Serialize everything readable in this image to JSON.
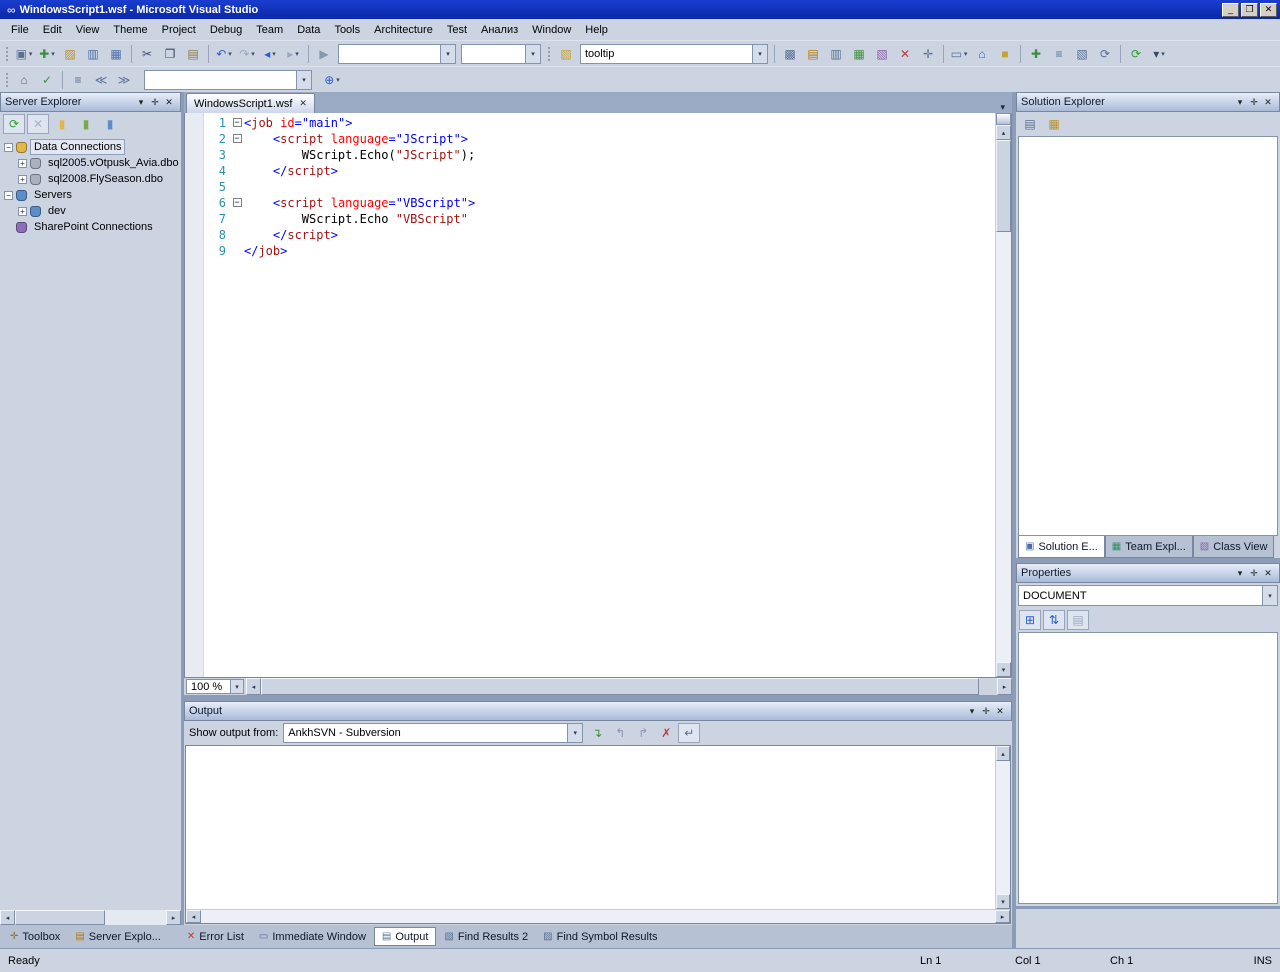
{
  "glyphs": {
    "up": "▴",
    "down": "▾",
    "left": "◂",
    "right": "▸",
    "dd": "▾",
    "menu": "▾",
    "pin": "✛",
    "close": "✕",
    "minimize": "_",
    "restore": "❐",
    "infinity": "∞"
  },
  "window": {
    "title": "WindowsScript1.wsf - Microsoft Visual Studio"
  },
  "menu_bar": {
    "items": [
      "File",
      "Edit",
      "View",
      "Theme",
      "Project",
      "Debug",
      "Team",
      "Data",
      "Tools",
      "Architecture",
      "Test",
      "Анализ",
      "Window",
      "Help"
    ]
  },
  "toolbar_standard": {
    "config_combo": "",
    "platform_combo": "",
    "tooltip_combo": "tooltip",
    "groups": {
      "file": [
        {
          "name": "new-project",
          "glyph": "▣",
          "color": "#5a6f94",
          "split": true
        },
        {
          "name": "add-new-item",
          "glyph": "✚",
          "color": "#3f8f3f",
          "split": true
        },
        {
          "name": "open-file",
          "glyph": "▨",
          "color": "#b8912e"
        },
        {
          "name": "save",
          "glyph": "▥",
          "color": "#4a6da8"
        },
        {
          "name": "save-all",
          "glyph": "▦",
          "color": "#4a6da8"
        }
      ],
      "clipboard": [
        {
          "name": "cut",
          "glyph": "✂",
          "color": "#3a4a66"
        },
        {
          "name": "copy",
          "glyph": "❐",
          "color": "#3a4a66"
        },
        {
          "name": "paste",
          "glyph": "▤",
          "color": "#8a7a4a"
        }
      ],
      "undo_redo": [
        {
          "name": "undo",
          "glyph": "↶",
          "color": "#2b5fd0",
          "split": true
        },
        {
          "name": "redo",
          "glyph": "↷",
          "color": "#9aa7bd",
          "split": true
        },
        {
          "name": "navigate-backward",
          "glyph": "◂",
          "color": "#2b5fd0",
          "split": true
        },
        {
          "name": "navigate-forward",
          "glyph": "▸",
          "color": "#9aa7bd",
          "split": true
        }
      ],
      "run": [
        {
          "name": "start-debug",
          "glyph": "▶",
          "color": "#8a97ad"
        }
      ],
      "find": [
        {
          "name": "find-options",
          "glyph": "▧",
          "color": "#c8a02e"
        }
      ],
      "windows": [
        {
          "name": "find-in-files",
          "glyph": "▩",
          "color": "#5a6f94"
        },
        {
          "name": "solution-explorer",
          "glyph": "▤",
          "color": "#b8780a"
        },
        {
          "name": "properties-window",
          "glyph": "▥",
          "color": "#5a6f94"
        },
        {
          "name": "object-browser",
          "glyph": "▦",
          "color": "#3f8f3f"
        },
        {
          "name": "class-view",
          "glyph": "▧",
          "color": "#8a5fb0"
        },
        {
          "name": "error-list",
          "glyph": "✕",
          "color": "#c03a3a"
        },
        {
          "name": "toolbox",
          "glyph": "✛",
          "color": "#5a6f94"
        }
      ],
      "tail1": [
        {
          "name": "command-window",
          "glyph": "▭",
          "color": "#5a6f94",
          "split": true
        },
        {
          "name": "web-browser",
          "glyph": "⌂",
          "color": "#2b5fd0"
        },
        {
          "name": "extension-manager",
          "glyph": "■",
          "color": "#c8a02e"
        }
      ],
      "tail2": [
        {
          "name": "add-to-source-control",
          "glyph": "✚",
          "color": "#3f8f3f"
        },
        {
          "name": "compare-files",
          "glyph": "≡",
          "color": "#5a6f94"
        },
        {
          "name": "annotate",
          "glyph": "▧",
          "color": "#5a6f94"
        },
        {
          "name": "history",
          "glyph": "⟳",
          "color": "#5a6f94"
        }
      ],
      "tail3": [
        {
          "name": "refresh",
          "glyph": "⟳",
          "color": "#2e9e2e"
        },
        {
          "name": "toolbar-options",
          "glyph": "▾",
          "color": "#3a4a66",
          "split": true
        }
      ]
    }
  },
  "toolbar_html": {
    "combo_value": "",
    "groups": {
      "left": [
        {
          "name": "view-in-browser",
          "glyph": "⌂",
          "color": "#5a6f94"
        },
        {
          "name": "check-syntax",
          "glyph": "✓",
          "color": "#3f8f3f"
        }
      ],
      "format": [
        {
          "name": "format-document",
          "glyph": "≡",
          "color": "#5a6f94"
        },
        {
          "name": "decrease-indent",
          "glyph": "≪",
          "color": "#5a6f94"
        },
        {
          "name": "increase-indent",
          "glyph": "≫",
          "color": "#5a6f94"
        }
      ],
      "browse": [
        {
          "name": "browse-with",
          "glyph": "⊕",
          "color": "#2b5fd0",
          "split": true
        }
      ]
    }
  },
  "server_explorer": {
    "title": "Server Explorer",
    "toolbar": [
      {
        "name": "refresh",
        "glyph": "⟳",
        "color": "#2e9e2e",
        "boxed": true
      },
      {
        "name": "stop-refresh",
        "glyph": "✕",
        "color": "#a8b2c2",
        "boxed": true
      },
      {
        "name": "connect-to-database",
        "glyph": "▮",
        "color": "#e3b64a"
      },
      {
        "name": "create-new-sql-database",
        "glyph": "▮",
        "color": "#7aa84a"
      },
      {
        "name": "connect-to-server",
        "glyph": "▮",
        "color": "#5b8dc8"
      }
    ],
    "tree": [
      {
        "label": "Data Connections",
        "indent": 0,
        "expander": "−",
        "icon": "data-connections",
        "icon_color": "#e3b64a",
        "selected": true
      },
      {
        "label": "sql2005.vOtpusk_Avia.dbo",
        "indent": 1,
        "expander": "+",
        "icon": "database",
        "icon_color": "#aab2c0",
        "selected": false
      },
      {
        "label": "sql2008.FlySeason.dbo",
        "indent": 1,
        "expander": "+",
        "icon": "database",
        "icon_color": "#aab2c0",
        "selected": false
      },
      {
        "label": "Servers",
        "indent": 0,
        "expander": "−",
        "icon": "servers",
        "icon_color": "#5b8dc8",
        "selected": false
      },
      {
        "label": "dev",
        "indent": 1,
        "expander": "+",
        "icon": "server",
        "icon_color": "#5b8dc8",
        "selected": false
      },
      {
        "label": "SharePoint Connections",
        "indent": 0,
        "expander": null,
        "icon": "sharepoint-connections",
        "icon_color": "#8a6fb8",
        "selected": false
      }
    ]
  },
  "editor": {
    "tab_title": "WindowsScript1.wsf",
    "zoom_value": "100 %",
    "code_lines": [
      {
        "num": "1",
        "fold": "−",
        "segs": [
          [
            "<",
            "d"
          ],
          [
            "job",
            "n"
          ],
          [
            " ",
            "x"
          ],
          [
            "id",
            "a"
          ],
          [
            "=",
            "d"
          ],
          [
            "\"main\"",
            "v"
          ],
          [
            ">",
            "d"
          ]
        ]
      },
      {
        "num": "2",
        "fold": "−",
        "segs": [
          [
            "    ",
            "x"
          ],
          [
            "<",
            "d"
          ],
          [
            "script",
            "n"
          ],
          [
            " ",
            "x"
          ],
          [
            "language",
            "a"
          ],
          [
            "=",
            "d"
          ],
          [
            "\"JScript\"",
            "v"
          ],
          [
            ">",
            "d"
          ]
        ]
      },
      {
        "num": "3",
        "fold": null,
        "segs": [
          [
            "        WScript.Echo(",
            "x"
          ],
          [
            "\"JScript\"",
            "s"
          ],
          [
            ");",
            "x"
          ]
        ]
      },
      {
        "num": "4",
        "fold": null,
        "segs": [
          [
            "    ",
            "x"
          ],
          [
            "</",
            "d"
          ],
          [
            "script",
            "n"
          ],
          [
            ">",
            "d"
          ]
        ]
      },
      {
        "num": "5",
        "fold": null,
        "segs": []
      },
      {
        "num": "6",
        "fold": "−",
        "segs": [
          [
            "    ",
            "x"
          ],
          [
            "<",
            "d"
          ],
          [
            "script",
            "n"
          ],
          [
            " ",
            "x"
          ],
          [
            "language",
            "a"
          ],
          [
            "=",
            "d"
          ],
          [
            "\"VBScript\"",
            "v"
          ],
          [
            ">",
            "d"
          ]
        ]
      },
      {
        "num": "7",
        "fold": null,
        "segs": [
          [
            "        WScript.Echo ",
            "x"
          ],
          [
            "\"VBScript\"",
            "s"
          ]
        ]
      },
      {
        "num": "8",
        "fold": null,
        "segs": [
          [
            "    ",
            "x"
          ],
          [
            "</",
            "d"
          ],
          [
            "script",
            "n"
          ],
          [
            ">",
            "d"
          ]
        ]
      },
      {
        "num": "9",
        "fold": null,
        "segs": [
          [
            "</",
            "d"
          ],
          [
            "job",
            "n"
          ],
          [
            ">",
            "d"
          ]
        ]
      }
    ]
  },
  "output": {
    "title": "Output",
    "show_output_label": "Show output from:",
    "source_combo": "AnkhSVN - Subversion",
    "toolbar": [
      {
        "name": "goto-message",
        "glyph": "↴",
        "color": "#3f8f3f"
      },
      {
        "name": "goto-previous-message",
        "glyph": "↰",
        "color": "#8a97ad"
      },
      {
        "name": "goto-next-message",
        "glyph": "↱",
        "color": "#8a97ad"
      },
      {
        "name": "clear-all",
        "glyph": "✗",
        "color": "#c03a3a"
      },
      {
        "name": "toggle-word-wrap",
        "glyph": "↵",
        "color": "#5a6f94",
        "boxed": true
      }
    ]
  },
  "solution_explorer": {
    "title": "Solution Explorer",
    "toolbar": [
      {
        "name": "properties",
        "glyph": "▤",
        "color": "#5a6f94"
      },
      {
        "name": "show-all-files",
        "glyph": "▦",
        "color": "#b8912e"
      }
    ],
    "tabs": [
      {
        "label": "Solution E...",
        "icon": "▣",
        "icon_color": "#4a6da8",
        "active": true
      },
      {
        "label": "Team Expl...",
        "icon": "▦",
        "icon_color": "#2b8f5f",
        "active": false
      },
      {
        "label": "Class View",
        "icon": "▧",
        "icon_color": "#8a5fb0",
        "active": false
      }
    ]
  },
  "properties": {
    "title": "Properties",
    "object_combo": "DOCUMENT",
    "toolbar": [
      {
        "name": "categorized",
        "glyph": "⊞",
        "color": "#2b5fd0",
        "boxed": true
      },
      {
        "name": "alphabetical",
        "glyph": "⇅",
        "color": "#2b5fd0",
        "boxed": true
      },
      {
        "name": "property-pages",
        "glyph": "▤",
        "color": "#9aa7bd",
        "boxed": true
      }
    ]
  },
  "bottom_tabs": {
    "left": [
      {
        "label": "Toolbox",
        "icon": "✛",
        "icon_color": "#8a6f3a",
        "active": false
      },
      {
        "label": "Server Explo...",
        "icon": "▤",
        "icon_color": "#b8780a",
        "active": false
      }
    ],
    "main": [
      {
        "label": "Error List",
        "icon": "✕",
        "icon_color": "#c03a3a",
        "active": false
      },
      {
        "label": "Immediate Window",
        "icon": "▭",
        "icon_color": "#5a6f94",
        "active": false
      },
      {
        "label": "Output",
        "icon": "▤",
        "icon_color": "#5a6f94",
        "active": true
      },
      {
        "label": "Find Results 2",
        "icon": "▧",
        "icon_color": "#5a6f94",
        "active": false
      },
      {
        "label": "Find Symbol Results",
        "icon": "▨",
        "icon_color": "#5a6f94",
        "active": false
      }
    ]
  },
  "status_bar": {
    "message": "Ready",
    "line": "Ln 1",
    "column": "Col 1",
    "character": "Ch 1",
    "mode": "INS"
  }
}
